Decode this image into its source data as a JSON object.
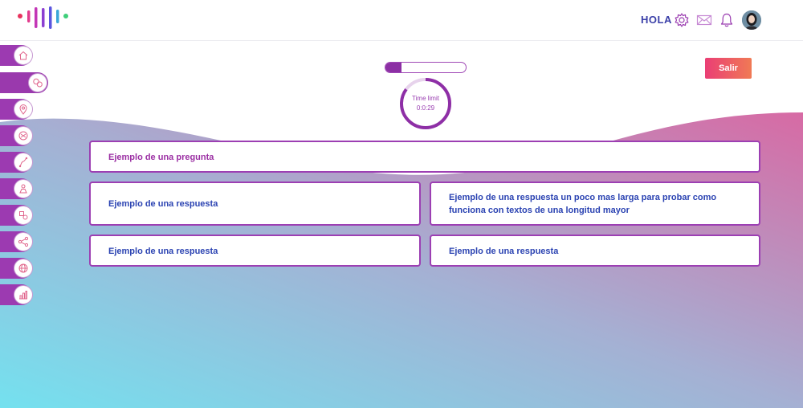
{
  "header": {
    "greeting": "HOLA",
    "icons": [
      "settings-icon",
      "mail-icon",
      "bell-icon",
      "avatar"
    ]
  },
  "sidebar": {
    "items": [
      {
        "icon": "home-icon"
      },
      {
        "icon": "chat-icon",
        "active": true
      },
      {
        "icon": "location-icon"
      },
      {
        "icon": "palette-icon"
      },
      {
        "icon": "route-icon"
      },
      {
        "icon": "person-icon"
      },
      {
        "icon": "shapes-icon"
      },
      {
        "icon": "share-icon"
      },
      {
        "icon": "globe-icon"
      },
      {
        "icon": "chart-icon"
      }
    ]
  },
  "quiz": {
    "progress": 0.2,
    "timer_label": "Time limit",
    "timer_value": "0:0:29",
    "timer_fraction": 0.85,
    "exit_label": "Salir",
    "question": "Ejemplo de una pregunta",
    "answers": [
      "Ejemplo de una respuesta",
      "Ejemplo de una respuesta un poco mas larga para probar como funciona con textos de una longitud mayor",
      "Ejemplo de una respuesta",
      "Ejemplo de una respuesta"
    ]
  },
  "colors": {
    "accent": "#9c3ab1",
    "exit_start": "#ea3e75",
    "exit_end": "#f07a55",
    "answer_text": "#2b43b2",
    "question_text": "#9b2fa3"
  }
}
